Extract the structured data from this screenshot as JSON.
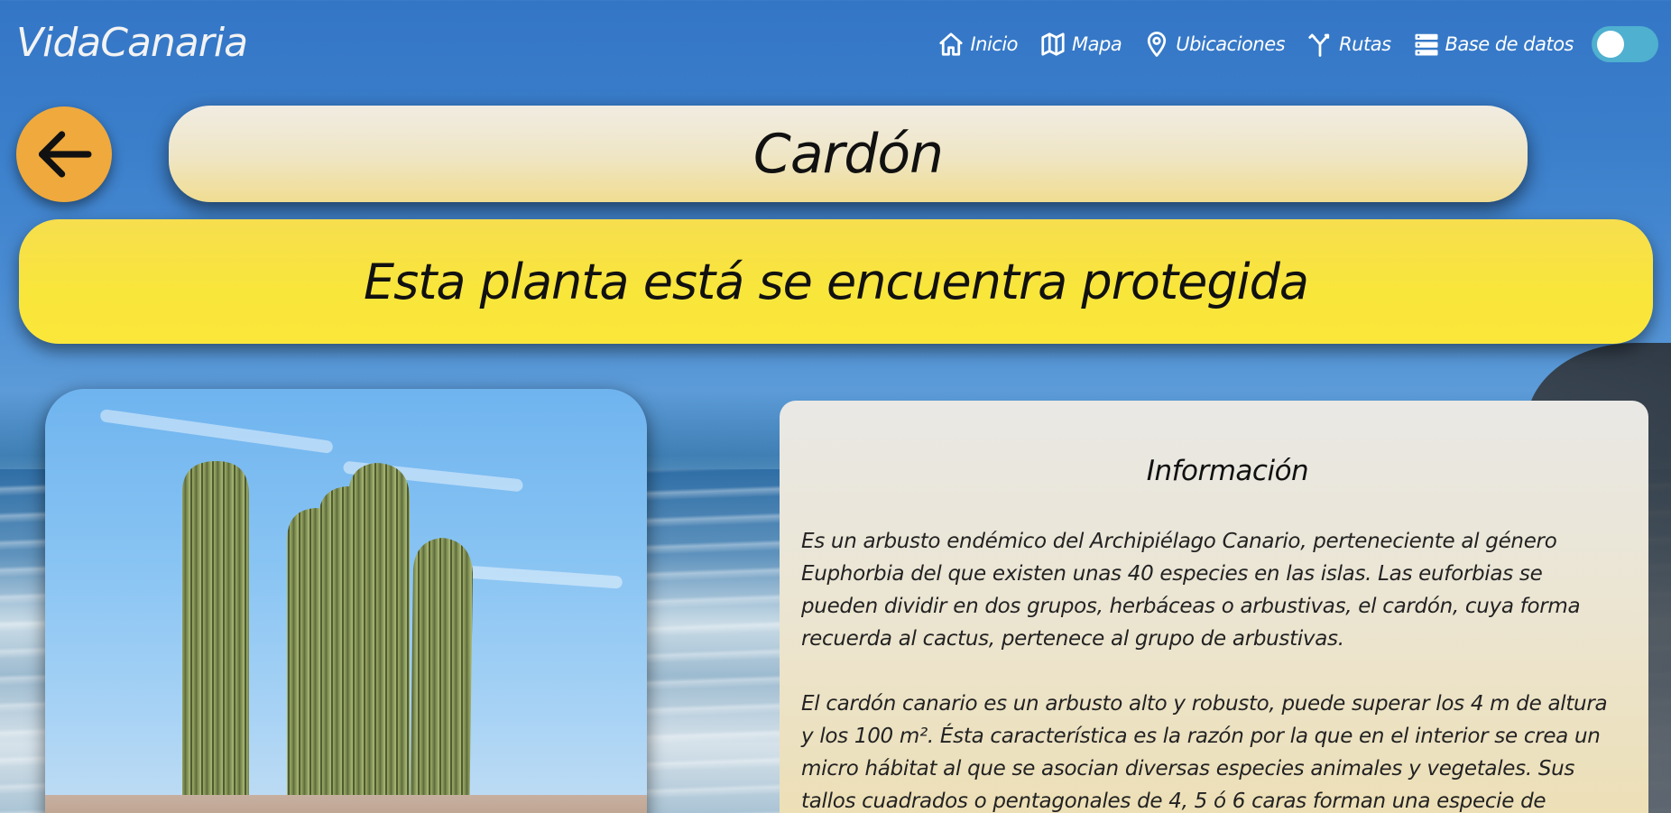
{
  "header": {
    "logo": "VidaCanaria",
    "nav": [
      {
        "label": "Inicio",
        "icon": "home-icon"
      },
      {
        "label": "Mapa",
        "icon": "map-icon"
      },
      {
        "label": "Ubicaciones",
        "icon": "location-pin-icon"
      },
      {
        "label": "Rutas",
        "icon": "routes-icon"
      },
      {
        "label": "Base de datos",
        "icon": "database-icon"
      }
    ],
    "theme_toggle": {
      "state": "off",
      "icon": "toggle-switch-icon"
    }
  },
  "back_button": {
    "icon": "arrow-left-icon"
  },
  "page": {
    "title": "Cardón",
    "protected_notice": "Esta planta está se encuentra protegida"
  },
  "info": {
    "heading": "Información",
    "paragraphs": [
      "Es un arbusto endémico del Archipiélago Canario, perteneciente al género Euphorbia del que existen unas 40 especies en las islas. Las euforbias se pueden dividir en dos grupos, herbáceas o arbustivas, el cardón, cuya forma recuerda al cactus, pertenece al grupo de arbustivas.",
      "El cardón canario es un arbusto alto y robusto, puede superar los 4 m de altura y los 100 m². Ésta característica es la razón por la que en el interior se crea un micro hábitat al que se asocian diversas especies animales y vegetales. Sus tallos cuadrados o pentagonales de 4, 5 ó 6 caras forman una especie de candelabro y"
    ]
  },
  "colors": {
    "back_button": "#efa93c",
    "banner": "#f9e63a",
    "title_pill": "#efe6c7",
    "toggle": "#4fb0cf"
  }
}
